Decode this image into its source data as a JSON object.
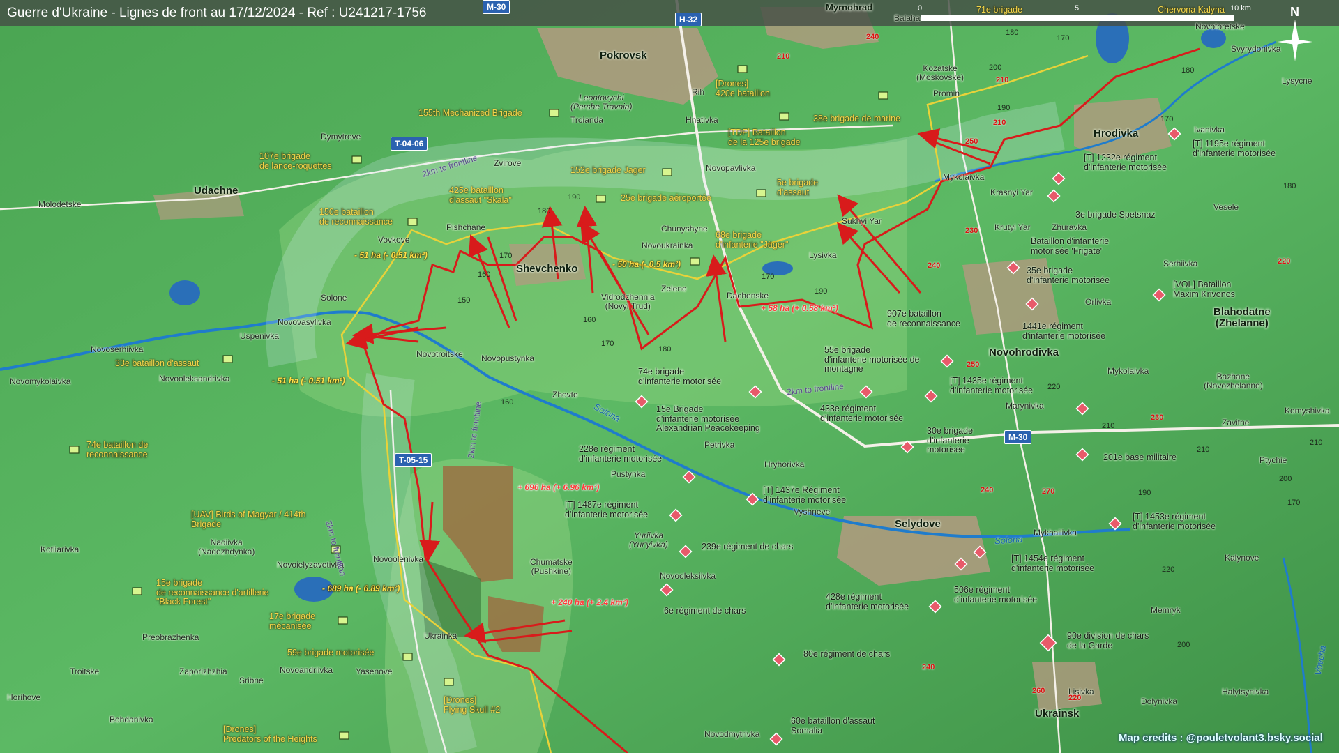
{
  "title": "Guerre d'Ukraine - Lignes de front au 17/12/2024 - Ref : U241217-1756",
  "scale": {
    "zero": "0",
    "mid": "5",
    "end": "10 km"
  },
  "compass": "N",
  "credits": "Map credits : @pouletvolant3.bsky.social",
  "roads": {
    "m30_top": "M-30",
    "h32": "H-32",
    "t0406": "T-04-06",
    "t0515": "T-05-15",
    "m30_right": "M-30"
  },
  "cities": {
    "pokrovsk": "Pokrovsk",
    "shevchenko": "Shevchenko",
    "udachne": "Udachne",
    "hrodivka": "Hrodivka",
    "novohrodivka": "Novohrodivka",
    "selydove": "Selydove",
    "ukrainsk": "Ukrainsk",
    "myrnohrad": "Myrnohrad",
    "blahodatne": "Blahodatne\n(Zhelanne)"
  },
  "towns": {
    "dymytrove": "Dymytrove",
    "molodetske": "Molodetske",
    "vovkove": "Vovkove",
    "pishchane": "Pishchane",
    "solone": "Solone",
    "novovasylivka": "Novovasylivka",
    "uspenivka": "Uspenivka",
    "novoserhiivka": "Novoserhiivka",
    "novomykolaivka": "Novomykolaivka",
    "novooleksandrivka": "Novooleksandrivka",
    "novotroitske": "Novotroitske",
    "novopustynka": "Novopustynka",
    "zhovte": "Zhovte",
    "vidrodzhennia": "Vidrodzhennia\n(Novyi Trud)",
    "zelene": "Zelene",
    "dachenske": "Dachenske",
    "novoukrainka": "Novoukrainka",
    "chunyshyne": "Chunyshyne",
    "lysivka": "Lysivka",
    "sukhyi_yar": "Sukhyi Yar",
    "novopavlivka": "Novopavlivka",
    "hnativka": "Hnativka",
    "rih": "Rih",
    "leontovychi": "Leontovychi\n(Pershe Travnia)",
    "troianda": "Troianda",
    "zvirove": "Zvirove",
    "balaha": "Balaha",
    "kozatske": "Kozatske\n(Moskovske)",
    "promin": "Promin",
    "mykolaivka": "Mykolaivka",
    "krasnyi_yar": "Krasnyi Yar",
    "krutyi_yar": "Krutyi Yar",
    "zhuravka": "Zhuravka",
    "orlivka": "Orlivka",
    "serhiivka": "Serhiivka",
    "vesele": "Vesele",
    "ivanivka": "Ivanivka",
    "lysycne": "Lysycne",
    "novotoretske": "Novotoretske",
    "svyrydonivka": "Svyrydonivka",
    "mykolaivka2": "Mykolaivka",
    "bazhane": "Bazhane\n(Novozhelanne)",
    "marynivka": "Marynivka",
    "komyshivka": "Komyshivka",
    "zavitne": "Zavitne",
    "ptychie": "Ptychie",
    "mykhailivka": "Mykhailivka",
    "kalynove": "Kalynove",
    "memryk": "Memryk",
    "halytsynivka": "Halytsynivka",
    "dolynivka": "Dolynivka",
    "lisivka": "Lisivka",
    "hryhorivka": "Hryhorivka",
    "petrivka": "Petrivka",
    "pustynka": "Pustynka",
    "vyshneve": "Vyshneve",
    "yuriivka": "Yuriivka\n(Yur'yivka)",
    "novooleksiivka": "Novooleksiivka",
    "chumatske": "Chumatske\n(Pushkine)",
    "novoolenivka": "Novoolenivka",
    "novoielyzavetivka": "Novoielyzavetivka",
    "nadiivka": "Nadiivka\n(Nadezhdynka)",
    "kotliarivka": "Kotliarivka",
    "preobrazhenka": "Preobrazhenka",
    "ukrainka": "Ukrainka",
    "troitske": "Troitske",
    "zaporizhzhia": "Zaporizhzhia",
    "sribne": "Sribne",
    "novoandriivka": "Novoandriivka",
    "yasenove": "Yasenove",
    "horihove": "Horihove",
    "bohdanivka": "Bohdanivka",
    "novodmytrivka": "Novodmytrivka"
  },
  "units": {
    "u155mech": "155th Mechanized Brigade",
    "u107": "107e brigade\nde lance-roquettes",
    "u150": "150e bataillon\nde reconnaissance",
    "u425": "425e bataillon\nd'assaut \"Skala\"",
    "u152": "152e brigade Jager",
    "u25": "25e brigade aéroportée",
    "u5": "5e brigade\nd'assaut",
    "u68": "68e brigade\nd'infanterie \"Jäger\"",
    "udrones420": "[Drones]\n420e bataillon",
    "utdf125": "[TDF] Bataillon\nde la 125e brigade",
    "u38": "38e brigade de marine",
    "u33": "33e bataillon d'assaut",
    "u74bat": "74e bataillon de\nreconnaissance",
    "uuav": "[UAV] Birds of Magyar / 414th\nBrigade",
    "u15reco": "15e brigade\nde reconnaissance d'artillerie\n\"Black Forest\"",
    "u17": "17e brigade\nmécanisée",
    "u59": "59e brigade motorisée",
    "udrones_fs": "[Drones]\nFlying Skull #2",
    "udrones_ph": "[Drones]\nPredators of the Heights",
    "u71": "71e brigade",
    "uchervona": "Chervona Kalyna"
  },
  "units_ru": {
    "r1232": "[T] 1232e régiment\nd'infanterie motorisée",
    "r1195": "[T] 1195e régiment\nd'infanterie motorisée",
    "r3spets": "3e brigade Spetsnaz",
    "rfrigate": "Bataillon d'infanterie\nmotorisée 'Frigate'",
    "r35": "35e brigade\nd'infanterie motorisée",
    "rvol": "[VOL] Bataillon\nMaxim Krivonos",
    "r907": "907e bataillon\nde reconnaissance",
    "r1441": "1441e régiment\nd'infanterie motorisée",
    "r55": "55e brigade\nd'infanterie motorisée de\nmontagne",
    "r1435": "[T] 1435e régiment\nd'infanterie motorisée",
    "r74": "74e brigade\nd'infanterie motorisée",
    "r433": "433e régiment\nd'infanterie motorisée",
    "r15": "15e Brigade\nd'infanterie motorisée\nAlexandrian Peacekeeping",
    "r30": "30e brigade\nd'infanterie\nmotorisée",
    "r201": "201e base militaire",
    "r228": "228e régiment\nd'infanterie motorisée",
    "r1437": "[T] 1437e Régiment\nd'infanterie motorisée",
    "r1487": "[T] 1487e régiment\nd'infanterie motorisée",
    "r1453": "[T] 1453e régiment\nd'infanterie motorisée",
    "r239": "239e régiment de chars",
    "r1454": "[T] 1454e régiment\nd'infanterie motorisée",
    "r6": "6e régiment de chars",
    "r506": "506e régiment\nd'infanterie motorisée",
    "r428": "428e régiment\nd'infanterie motorisée",
    "r90": "90e division de chars\nde la Garde",
    "r80": "80e régiment de chars",
    "r60": "60e bataillon d'assaut\nSomalia"
  },
  "area_changes": {
    "a1": "- 51 ha (- 0.51 km²)",
    "a2": "- 50 ha (- 0.5 km²)",
    "a3": "+ 58 ha (+ 0.58 km²)",
    "a4": "- 51 ha (- 0.51 km²)",
    "a5": "+ 696 ha (+ 6.96 km²)",
    "a6": "- 689 ha (- 6.89 km²)",
    "a7": "+ 240 ha (+ 2.4 km²)"
  },
  "km_labels": {
    "k1": "2km to frontline",
    "k2": "2km to frontline",
    "k3": "2km to frontline",
    "k4": "2km to frontline"
  },
  "rivers": {
    "s1": "Solona",
    "s2": "Solona",
    "v": "Vovcha"
  },
  "elevations": {
    "e180a": "180",
    "e190a": "190",
    "e170a": "170",
    "e160a": "160",
    "e150a": "150",
    "e170b": "170",
    "e160b": "160",
    "e180b": "180",
    "e170c": "170",
    "e190b": "190",
    "e160c": "160",
    "e180c": "180",
    "e200": "200",
    "e170d": "170",
    "e190c": "190",
    "e180d": "180",
    "e170e": "170",
    "e220a": "220",
    "e210a": "210",
    "e210b": "210",
    "e180e": "180",
    "e210c": "210",
    "e200b": "200",
    "e190d": "190",
    "e170f": "170",
    "e220b": "220",
    "e200c": "200"
  },
  "elev_red": {
    "r240a": "240",
    "r210a": "210",
    "r210b": "210",
    "r210c": "210",
    "r250a": "250",
    "r230": "230",
    "r240b": "240",
    "r220": "220",
    "r250b": "250",
    "r230b": "230",
    "r240c": "240",
    "r270": "270",
    "r240d": "240",
    "r260": "260",
    "r220b": "220"
  }
}
